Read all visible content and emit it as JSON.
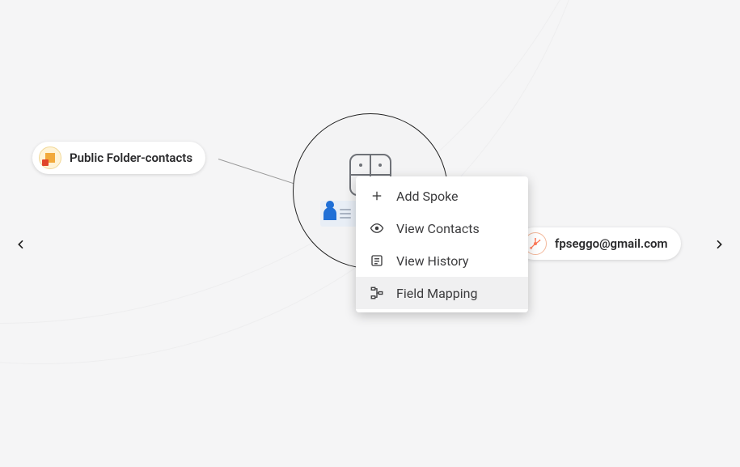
{
  "spokes": {
    "left": {
      "label": "Public Folder-contacts",
      "service": "office365"
    },
    "right": {
      "label": "fpseggo@gmail.com",
      "service": "hubspot"
    }
  },
  "hub": {
    "label": "Contacts Hub"
  },
  "menu": {
    "items": [
      {
        "label": "Add Spoke",
        "icon": "plus-icon",
        "highlighted": false
      },
      {
        "label": "View Contacts",
        "icon": "eye-icon",
        "highlighted": false
      },
      {
        "label": "View History",
        "icon": "list-icon",
        "highlighted": false
      },
      {
        "label": "Field Mapping",
        "icon": "mapping-icon",
        "highlighted": true
      }
    ]
  },
  "nav": {
    "prev": "Previous",
    "next": "Next"
  }
}
